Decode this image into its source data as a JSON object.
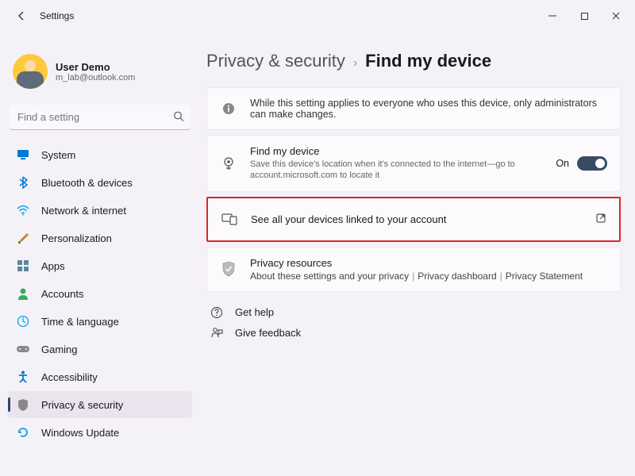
{
  "window": {
    "title": "Settings"
  },
  "user": {
    "name": "User Demo",
    "email": "m_lab@outlook.com"
  },
  "search": {
    "placeholder": "Find a setting"
  },
  "nav": {
    "system": "System",
    "bluetooth": "Bluetooth & devices",
    "network": "Network & internet",
    "personalization": "Personalization",
    "apps": "Apps",
    "accounts": "Accounts",
    "time": "Time & language",
    "gaming": "Gaming",
    "accessibility": "Accessibility",
    "privacy": "Privacy & security",
    "update": "Windows Update"
  },
  "breadcrumb": {
    "parent": "Privacy & security",
    "current": "Find my device"
  },
  "info_banner": "While this setting applies to everyone who uses this device, only administrators can make changes.",
  "find_device": {
    "title": "Find my device",
    "sub": "Save this device's location when it's connected to the internet—go to account.microsoft.com to locate it",
    "state": "On"
  },
  "see_all": {
    "label": "See all your devices linked to your account"
  },
  "resources": {
    "title": "Privacy resources",
    "link1": "About these settings and your privacy",
    "link2": "Privacy dashboard",
    "link3": "Privacy Statement"
  },
  "help": {
    "get_help": "Get help",
    "feedback": "Give feedback"
  }
}
